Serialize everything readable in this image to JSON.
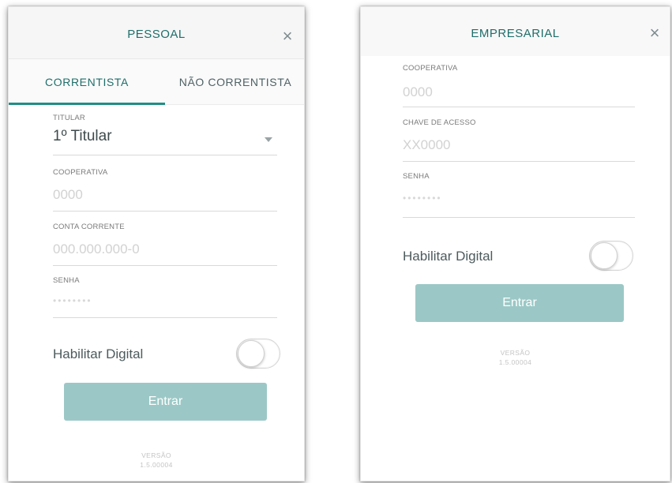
{
  "pessoal": {
    "title": "PESSOAL",
    "close_glyph": "×",
    "tabs": [
      {
        "label": "CORRENTISTA",
        "active": true
      },
      {
        "label": "NÃO CORRENTISTA",
        "active": false
      }
    ],
    "fields": {
      "titular": {
        "label": "TITULAR",
        "value": "1º Titular"
      },
      "cooperativa": {
        "label": "COOPERATIVA",
        "placeholder": "0000"
      },
      "conta_corrente": {
        "label": "CONTA CORRENTE",
        "placeholder": "000.000.000-0"
      },
      "senha": {
        "label": "SENHA",
        "placeholder": "••••••••"
      }
    },
    "toggle_label": "Habilitar Digital",
    "toggle_on": false,
    "submit_label": "Entrar",
    "version_label": "VERSÃO",
    "version_number": "1.5.00004"
  },
  "empresarial": {
    "title": "EMPRESARIAL",
    "close_glyph": "×",
    "fields": {
      "cooperativa": {
        "label": "COOPERATIVA",
        "placeholder": "0000"
      },
      "chave_acesso": {
        "label": "CHAVE DE ACESSO",
        "placeholder": "XX0000"
      },
      "senha": {
        "label": "SENHA",
        "placeholder": "••••••••"
      }
    },
    "toggle_label": "Habilitar Digital",
    "toggle_on": false,
    "submit_label": "Entrar",
    "version_label": "VERSÃO",
    "version_number": "1.5.00004"
  },
  "colors": {
    "accent": "#1f6e6a",
    "tab_indicator": "#1f8e87",
    "button": "#9bc8c6",
    "header_bg": "#f6f6f6"
  },
  "icons": {
    "close": "close-icon",
    "dropdown": "chevron-down-icon"
  }
}
